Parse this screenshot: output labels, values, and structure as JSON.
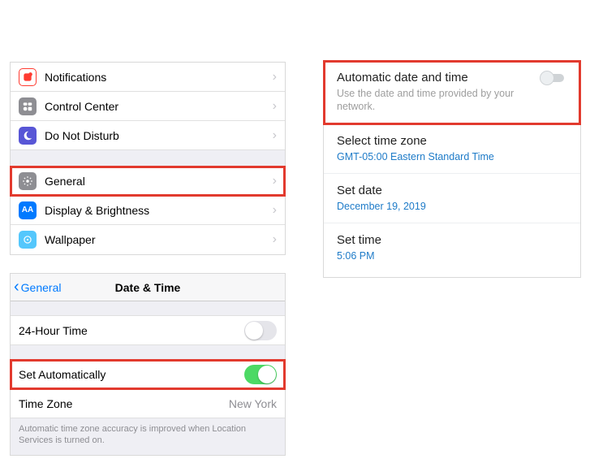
{
  "ios_settings": {
    "rows": [
      {
        "label": "Notifications",
        "icon_bg": "#ff3b30"
      },
      {
        "label": "Control Center",
        "icon_bg": "#8e8e93"
      },
      {
        "label": "Do Not Disturb",
        "icon_bg": "#5856d6"
      }
    ],
    "rows2": [
      {
        "label": "General",
        "icon_bg": "#8e8e93",
        "highlight": true
      },
      {
        "label": "Display & Brightness",
        "icon_bg": "#007aff"
      },
      {
        "label": "Wallpaper",
        "icon_bg": "#54c7fc"
      }
    ]
  },
  "ios_datetime": {
    "back_label": "General",
    "title": "Date & Time",
    "row_24h": "24-Hour Time",
    "row_auto": "Set Automatically",
    "row_tz_label": "Time Zone",
    "row_tz_value": "New York",
    "footnote": "Automatic time zone accuracy is improved when Location Services is turned on."
  },
  "android": {
    "auto": {
      "title": "Automatic date and time",
      "sub": "Use the date and time provided by your network."
    },
    "tz": {
      "title": "Select time zone",
      "sub": "GMT-05:00 Eastern Standard Time"
    },
    "date": {
      "title": "Set date",
      "sub": "December 19, 2019"
    },
    "time": {
      "title": "Set time",
      "sub": "5:06 PM"
    }
  }
}
